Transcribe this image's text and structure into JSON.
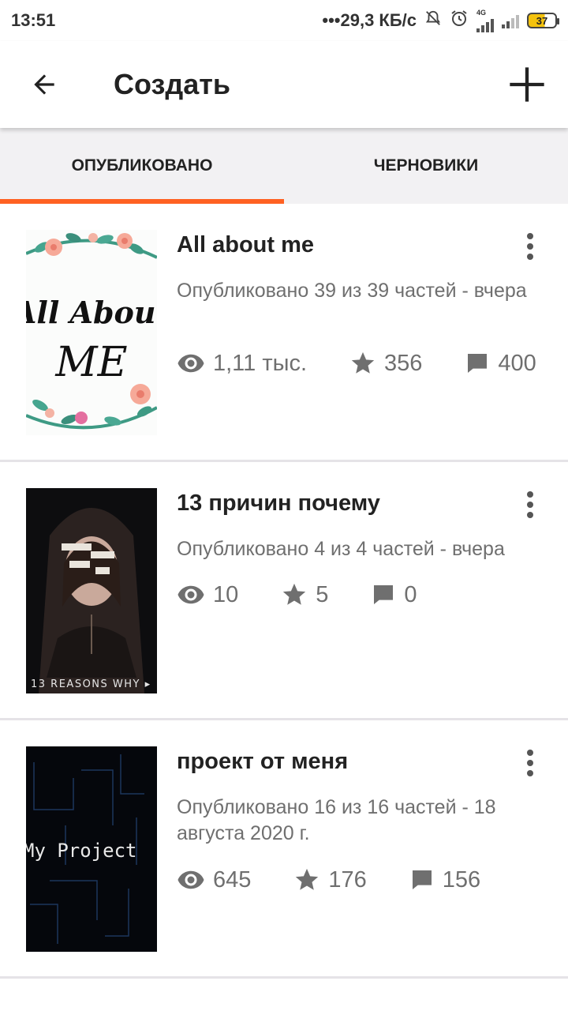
{
  "status_bar": {
    "time": "13:51",
    "network_speed": "•••29,3 КБ/с",
    "network_type": "4G",
    "battery": "37",
    "icons": [
      "mute-icon",
      "alarm-icon",
      "signal-icon",
      "battery-icon"
    ]
  },
  "toolbar": {
    "title": "Создать",
    "back_icon": "arrow-left-icon",
    "add_icon": "plus-icon"
  },
  "tabs": [
    {
      "label": "ОПУБЛИКОВАНО",
      "active": true
    },
    {
      "label": "ЧЕРНОВИКИ",
      "active": false
    }
  ],
  "accent_color": "#ff6122",
  "stories": [
    {
      "title": "All about me",
      "status": "Опубликовано 39 из 39 частей - вчера",
      "views": "1,11 тыс.",
      "votes": "356",
      "comments": "400",
      "cover_text": [
        "All About",
        "ME"
      ]
    },
    {
      "title": "13 причин почему",
      "status": "Опубликовано 4 из 4 частей - вчера",
      "views": "10",
      "votes": "5",
      "comments": "0",
      "cover_text": [
        "13 REASONS WHY ▸"
      ]
    },
    {
      "title": "проект от меня",
      "status": "Опубликовано 16 из 16 частей - 18 августа 2020 г.",
      "views": "645",
      "votes": "176",
      "comments": "156",
      "cover_text": [
        "My Project"
      ]
    }
  ]
}
